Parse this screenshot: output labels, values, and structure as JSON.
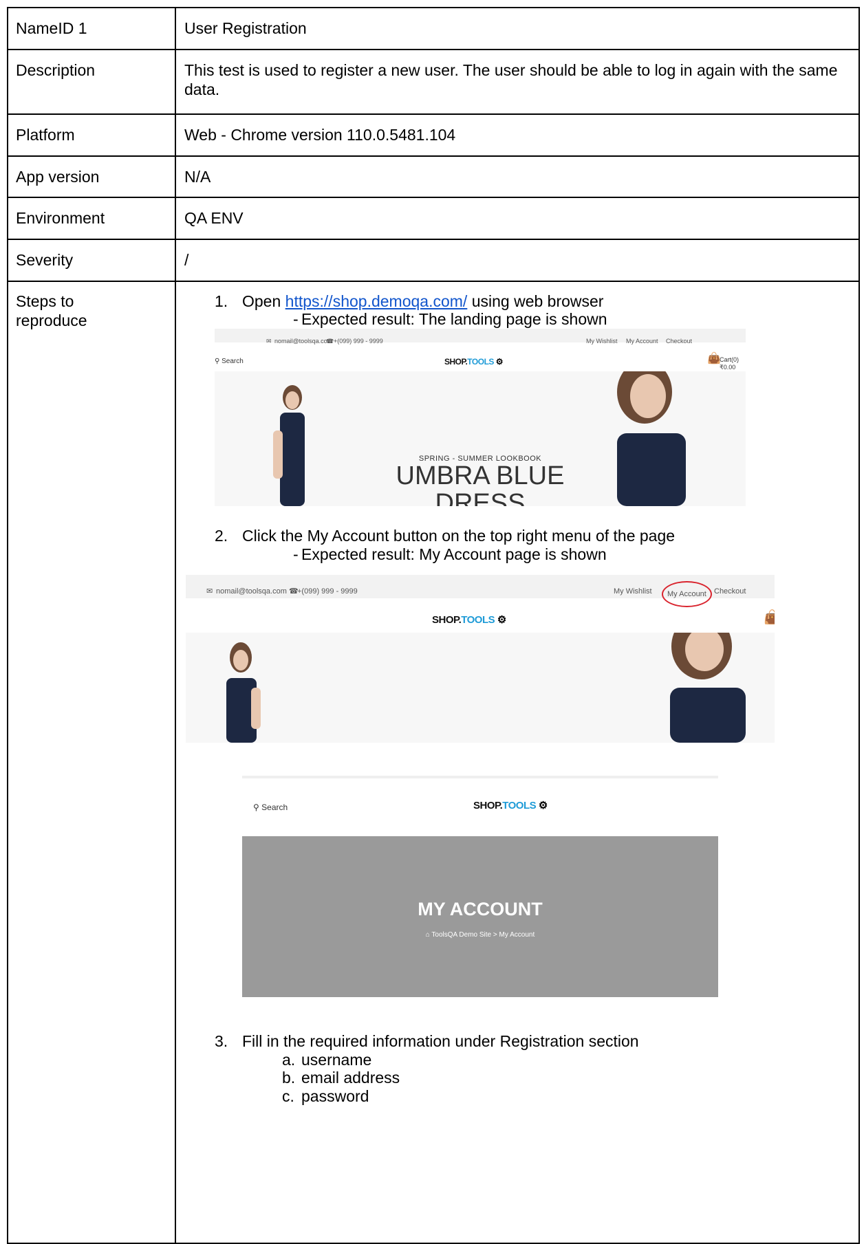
{
  "table": {
    "rows": [
      {
        "label": "NameID 1",
        "value": "User Registration"
      },
      {
        "label": "Description",
        "value": "This test is used to register a new user. The user should be able to log in again with the same data."
      },
      {
        "label": "Platform",
        "value": "Web - Chrome version 110.0.5481.104"
      },
      {
        "label": "App version",
        "value": "N/A"
      },
      {
        "label": "Environment",
        "value": "QA ENV"
      },
      {
        "label": "Severity",
        "value": "/"
      }
    ],
    "steps_label_line1": "Steps to",
    "steps_label_line2": "reproduce"
  },
  "steps": {
    "s1": {
      "num": "1.",
      "prefix": "Open",
      "link": "https://shop.demoqa.com/",
      "suffix": "using web browser",
      "dash": "-",
      "expected": "Expected result: The landing page is shown"
    },
    "s2": {
      "num": "2.",
      "text": "Click the My Account button on the top right menu of the page",
      "dash": "-",
      "expected": "Expected result: My Account page is shown"
    },
    "s3": {
      "num": "3.",
      "text": "Fill in the required information under Registration section",
      "items": [
        {
          "marker": "a.",
          "text": "username"
        },
        {
          "marker": "b.",
          "text": "email address"
        },
        {
          "marker": "c.",
          "text": "password"
        }
      ]
    }
  },
  "site": {
    "email": "nomail@toolsqa.com",
    "phone": "+(099) 999 - 9999",
    "wishlist": "My Wishlist",
    "account": "My Account",
    "checkout": "Checkout",
    "search": "Search",
    "logo_shop": "SHOP.",
    "logo_tools": "TOOLS",
    "cart": "Cart(0)",
    "cart_total": "₹0.00",
    "hero_kicker": "SPRING - SUMMER LOOKBOOK",
    "hero_title": "UMBRA BLUE",
    "hero_title2": "DRESS",
    "myaccount_title": "MY ACCOUNT",
    "crumb_home": "ToolsQA Demo Site",
    "crumb_sep": ">",
    "crumb_current": "My Account",
    "highlight_color": "#d9232d",
    "dress_color": "#1d2842"
  }
}
